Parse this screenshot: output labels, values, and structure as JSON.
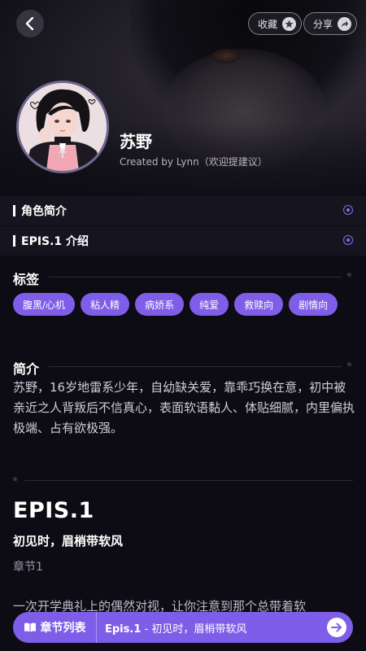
{
  "header": {
    "favorite_label": "收藏",
    "share_label": "分享"
  },
  "profile": {
    "name": "苏野",
    "creator": "Created by Lynn（欢迎提建议）"
  },
  "sections": {
    "role_intro": "角色简介",
    "epis_intro": "EPIS.1 介绍"
  },
  "tags": {
    "heading": "标签",
    "items": [
      "腹黑/心机",
      "粘人精",
      "病娇系",
      "纯爱",
      "救赎向",
      "剧情向"
    ]
  },
  "summary": {
    "heading": "简介",
    "text": "苏野，16岁地雷系少年，自幼缺关爱，靠乖巧换在意，初中被亲近之人背叛后不信真心，表面软语黏人、体贴细腻，内里偏执极端、占有欲极强。"
  },
  "episode": {
    "title": "EPIS.1",
    "subtitle": "初见时，眉梢带软风",
    "chapter": "章节1",
    "body": "一次开学典礼上的偶然对视，让你注意到那个总带着软"
  },
  "bottom": {
    "chapters_label": "章节列表",
    "current_ep": "Epis.1",
    "current_sep": " - ",
    "current_title": "初见时，眉梢带软风"
  },
  "colors": {
    "accent": "#7e5ee8",
    "background": "#0d0c14"
  },
  "icons": {
    "back": "chevron-left-icon",
    "favorite": "star-icon",
    "share": "share-arrow-icon",
    "section": "radio-dot-icon",
    "chapters": "book-icon",
    "go": "arrow-right-icon"
  }
}
